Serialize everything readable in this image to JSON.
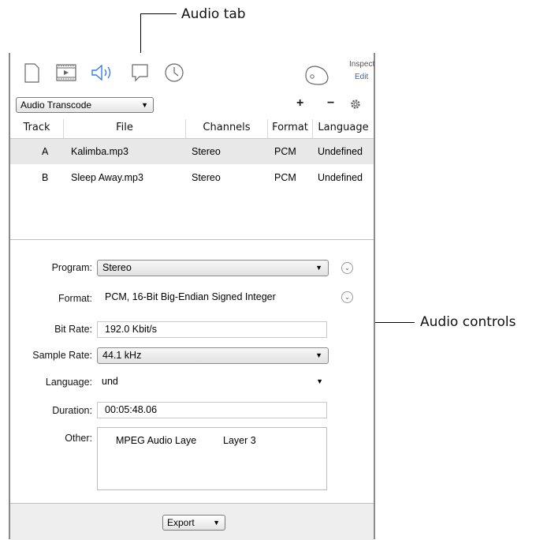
{
  "callouts": {
    "audio_tab": "Audio tab",
    "audio_controls": "Audio controls"
  },
  "toolbar": {
    "icons": [
      "document-icon",
      "video-icon",
      "audio-icon",
      "subtitle-icon",
      "clock-icon",
      "inspect-icon"
    ],
    "inspect_label": "Inspect",
    "edit_label": "Edit"
  },
  "action_bar": {
    "preset_value": "Audio Transcode",
    "add_label": "+",
    "remove_label": "−"
  },
  "table": {
    "columns": [
      "Track",
      "File",
      "Channels",
      "Format",
      "Language"
    ],
    "rows": [
      {
        "track": "A",
        "file": "Kalimba.mp3",
        "channels": "Stereo",
        "format": "PCM",
        "language": "Undefined"
      },
      {
        "track": "B",
        "file": "Sleep Away.mp3",
        "channels": "Stereo",
        "format": "PCM",
        "language": "Undefined"
      }
    ]
  },
  "form": {
    "program_label": "Program:",
    "program_value": "Stereo",
    "format_label": "Format:",
    "format_value": "PCM, 16-Bit Big-Endian Signed Integer",
    "bitrate_label": "Bit Rate:",
    "bitrate_value": "192.0 Kbit/s",
    "samplerate_label": "Sample Rate:",
    "samplerate_value": "44.1 kHz",
    "language_label": "Language:",
    "language_value": "und",
    "duration_label": "Duration:",
    "duration_value": "00:05:48.06",
    "other_label": "Other:",
    "other_value_1": "MPEG Audio Laye",
    "other_value_2": "Layer 3"
  },
  "footer": {
    "export_label": "Export"
  },
  "colors": {
    "accent": "#2a62d4",
    "selected_row": "#e8e8e8"
  }
}
